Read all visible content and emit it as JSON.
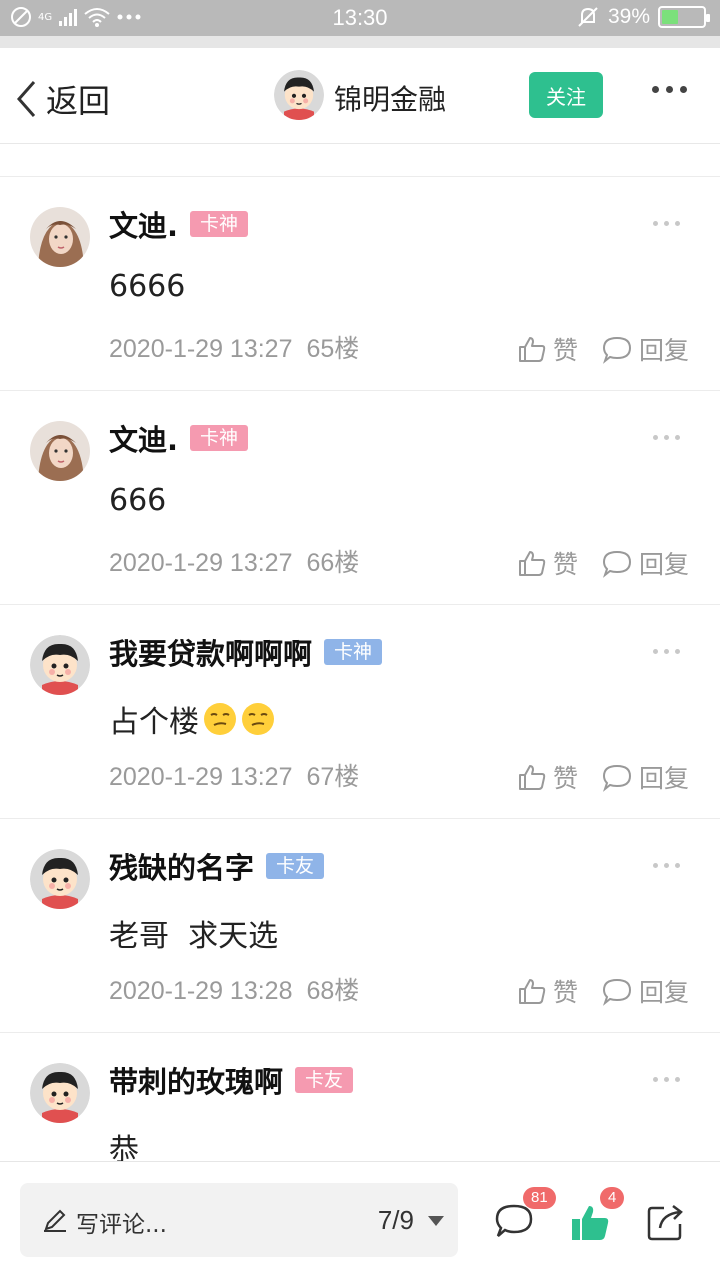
{
  "status_bar": {
    "time": "13:30",
    "network": "4G",
    "battery": "39%",
    "battery_level": 0.39
  },
  "header": {
    "back_label": "返回",
    "title": "锦明金融",
    "follow_label": "关注"
  },
  "colors": {
    "accent": "#2ec08f",
    "badge_kashen_pink": "#f59ab0",
    "badge_kashen_blue": "#8fb4e8",
    "badge_kayou_blue": "#8fb4e8",
    "badge_kayou_pink": "#f59ab0",
    "unread_red": "#f06a6a"
  },
  "comments": [
    {
      "author": "文迪.",
      "badge": "卡神",
      "badge_color": "#f59ab0",
      "avatar": "photo-avatar",
      "text": "6666",
      "time": "2020-1-29 13:27",
      "floor": "65楼",
      "like_label": "赞",
      "reply_label": "回复"
    },
    {
      "author": "文迪.",
      "badge": "卡神",
      "badge_color": "#f59ab0",
      "avatar": "photo-avatar",
      "text": "666",
      "time": "2020-1-29 13:27",
      "floor": "66楼",
      "like_label": "赞",
      "reply_label": "回复"
    },
    {
      "author": "我要贷款啊啊啊",
      "badge": "卡神",
      "badge_color": "#8fb4e8",
      "avatar": "cartoon-avatar",
      "text": "占个楼",
      "emojis": 2,
      "time": "2020-1-29 13:27",
      "floor": "67楼",
      "like_label": "赞",
      "reply_label": "回复"
    },
    {
      "author": "残缺的名字",
      "badge": "卡友",
      "badge_color": "#8fb4e8",
      "avatar": "cartoon-avatar",
      "text": "老哥  求天选",
      "time": "2020-1-29 13:28",
      "floor": "68楼",
      "like_label": "赞",
      "reply_label": "回复"
    },
    {
      "author": "带刺的玫瑰啊",
      "badge": "卡友",
      "badge_color": "#f59ab0",
      "avatar": "cartoon-avatar",
      "text": "恭",
      "time": "",
      "floor": "",
      "like_label": "",
      "reply_label": ""
    }
  ],
  "bottom_bar": {
    "write_placeholder": "写评论...",
    "page_indicator": "7/9",
    "comment_count": "81",
    "like_count": "4",
    "icons": [
      "comment-icon",
      "like-icon",
      "share-icon"
    ]
  }
}
